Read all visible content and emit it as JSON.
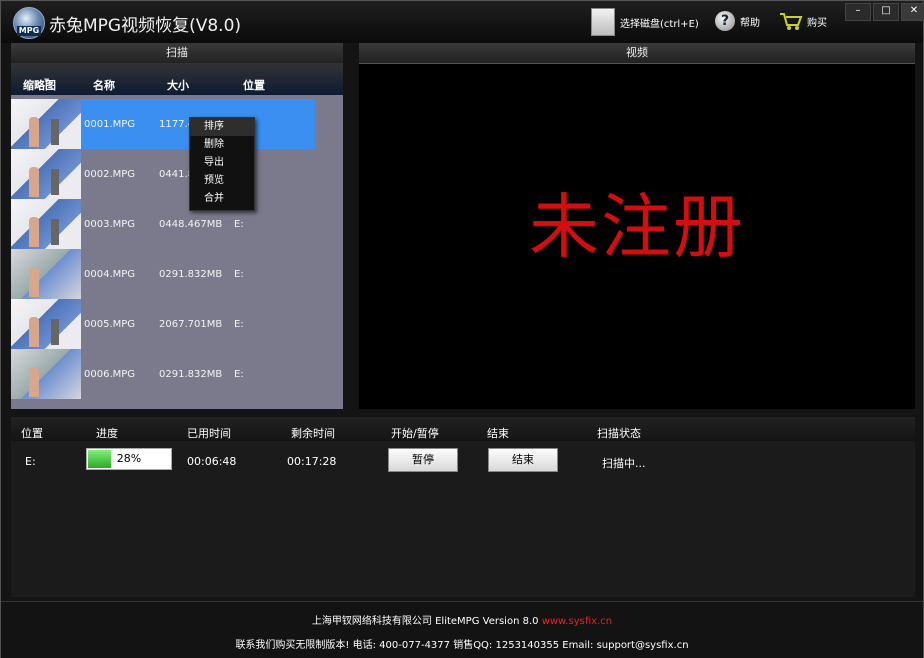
{
  "app": {
    "logo_label": "MPG",
    "title": "赤兔MPG视频恢复(V8.0)",
    "select_disk": "选择磁盘(ctrl+E)",
    "help": "帮助",
    "buy": "购买"
  },
  "scan": {
    "header": "扫描",
    "columns": {
      "thumb": "缩略图",
      "name": "名称",
      "size": "大小",
      "location": "位置"
    },
    "rows": [
      {
        "name": "0001.MPG",
        "size": "1177.4",
        "location": ""
      },
      {
        "name": "0002.MPG",
        "size": "0441.8",
        "location": ""
      },
      {
        "name": "0003.MPG",
        "size": "0448.467MB",
        "location": "E:"
      },
      {
        "name": "0004.MPG",
        "size": "0291.832MB",
        "location": "E:"
      },
      {
        "name": "0005.MPG",
        "size": "2067.701MB",
        "location": "E:"
      },
      {
        "name": "0006.MPG",
        "size": "0291.832MB",
        "location": "E:"
      }
    ],
    "context_menu": [
      "排序",
      "删除",
      "导出",
      "预览",
      "合并"
    ]
  },
  "video": {
    "header": "视频",
    "watermark": "未注册"
  },
  "progress": {
    "columns": [
      "位置",
      "进度",
      "已用时间",
      "剩余时间",
      "开始/暂停",
      "结束",
      "扫描状态"
    ],
    "location": "E:",
    "percent": 28,
    "percent_label": "28%",
    "elapsed": "00:06:48",
    "remaining": "00:17:28",
    "pause_label": "暂停",
    "stop_label": "结束",
    "status": "扫描中..."
  },
  "footer": {
    "company": "上海甲钗网络科技有限公司 EliteMPG Version 8.0",
    "website": "www.sysfix.cn",
    "contact": "联系我们购买无限制版本! 电话: 400-077-4377 销售QQ: 1253140355 Email: support@sysfix.cn"
  },
  "colors": {
    "selection": "#3a8ff0",
    "watermark": "#d10f0f",
    "progress": "#2ea82a"
  }
}
